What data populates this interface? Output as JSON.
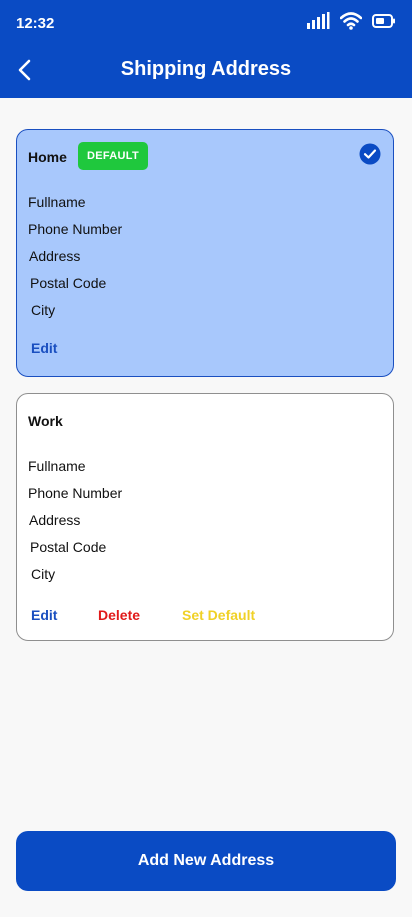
{
  "status_bar": {
    "time": "12:32",
    "icons": [
      "signal-icon",
      "wifi-icon",
      "battery-icon"
    ]
  },
  "header": {
    "title": "Shipping Address",
    "back_icon": "chevron-left-icon"
  },
  "addresses": [
    {
      "name": "Home",
      "badge": "DEFAULT",
      "selected": true,
      "fields": [
        "Fullname",
        "Phone Number",
        "Address",
        "Postal Code",
        "City"
      ],
      "actions": [
        "Edit"
      ]
    },
    {
      "name": "Work",
      "selected": false,
      "fields": [
        "Fullname",
        "Phone Number",
        "Address",
        "Postal Code",
        "City"
      ],
      "actions": [
        "Edit",
        "Delete",
        "Set Default"
      ]
    }
  ],
  "footer": {
    "add_button_label": "Add New Address"
  },
  "colors": {
    "primary": "#0a4bc4",
    "default_card_bg": "#a8c8fc",
    "badge_green": "#1fc83d",
    "edit_blue": "#1a4fc0",
    "delete_red": "#e11a1a",
    "set_default_yellow": "#f0d126"
  }
}
